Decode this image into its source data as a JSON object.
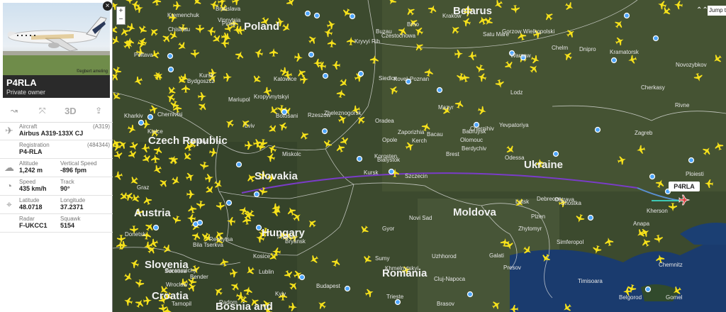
{
  "flight": {
    "registration": "P4RLA",
    "owner": "Private owner",
    "photo_credit": "©egbert ameling",
    "label_on_map": "P4RLA"
  },
  "toolbar": {
    "three_d": "3D"
  },
  "details": [
    {
      "label": "Aircraft",
      "value": "Airbus A319-133X CJ",
      "aux": "(A319)",
      "icon": "plane-icon"
    },
    {
      "label": "Registration",
      "value": "P4-RLA",
      "aux": "(484344)",
      "icon": ""
    },
    {
      "label": "Altitude",
      "value": "1,242 m",
      "label2": "Vertical Speed",
      "value2": "-896 fpm",
      "icon": "cloud-icon"
    },
    {
      "label": "Speed",
      "value": "435 km/h",
      "label2": "Track",
      "value2": "90°",
      "icon": "gauge-icon"
    },
    {
      "label": "Latitude",
      "value": "48.0718",
      "label2": "Longitude",
      "value2": "37.2371",
      "icon": "radar-icon"
    },
    {
      "label": "Radar",
      "value": "F-UKCC1",
      "label2": "Squawk",
      "value2": "5154",
      "icon": ""
    }
  ],
  "map_controls": {
    "zoom_in": "+",
    "zoom_out": "−",
    "jump": "Jump to",
    "collapse": "⌃⌃"
  },
  "countries": [
    "Poland",
    "Belarus",
    "Czech Republic",
    "Slovakia",
    "Ukraine",
    "Austria",
    "Hungary",
    "Moldova",
    "Slovenia",
    "Romania",
    "Croatia",
    "Bosnia and"
  ],
  "cities": [
    "Szczecin",
    "Bydgoszcz",
    "Bialystok",
    "Baranavichy",
    "Babruysk",
    "Bryansk",
    "Gorzow Wielkopolski",
    "Poznan",
    "Warsaw",
    "Brest",
    "Pinsk",
    "Gomel",
    "Klintsy",
    "Novozybkov",
    "Kursk",
    "Lodz",
    "Radom",
    "Siedlce",
    "Mazyr",
    "Rechytsa",
    "Zheleznogorsk",
    "Wroclaw",
    "Lublin",
    "Kovel",
    "Chernihiv",
    "Shostka",
    "Kursk",
    "Czestochowa",
    "Kielce",
    "Lutsk",
    "Rivne",
    "Korosten",
    "Sumy",
    "Opole",
    "Katowice",
    "Chelm",
    "Provary",
    "Belgorod",
    "Chemnitz",
    "Ostrava",
    "Krakow",
    "Rzeszow",
    "Lviv",
    "Zhytomyr",
    "Kyiv",
    "Kharkiv",
    "Olomouc",
    "Tarnopil",
    "Khmelnytskyi",
    "Berdychiv",
    "Bila Tserkva",
    "Cherkasy",
    "Poltava",
    "Plzen",
    "Presov",
    "Kosice",
    "Vinnytsia",
    "Kremenchuk",
    "Uzhhorod",
    "Kramatorsk",
    "Brno",
    "Miskolc",
    "Chernivtsi",
    "Kropyvnytskyi",
    "Dnipro",
    "Bratislava",
    "Satu Mare",
    "Kryvyi Rih",
    "Zaporizhia",
    "Donetsk",
    "Gyor",
    "Budapest",
    "Debrecen",
    "Botosani",
    "Suceava",
    "Chisinau",
    "Mariupol",
    "Graz",
    "Oradea",
    "Cluj-Napoca",
    "Bacau",
    "Bender",
    "Odessa",
    "Kherson",
    "Trieste",
    "Zagreb",
    "Novi Sad",
    "Timisoara",
    "Brasov",
    "Galati",
    "Buzau",
    "Ploiesti",
    "Yevpatoriya",
    "Simferopol",
    "Kerch",
    "Anapa"
  ],
  "colors": {
    "accent_track": "#7a3cc8",
    "plane": "#f7e21b",
    "map_bg": "#3b4a2e"
  }
}
